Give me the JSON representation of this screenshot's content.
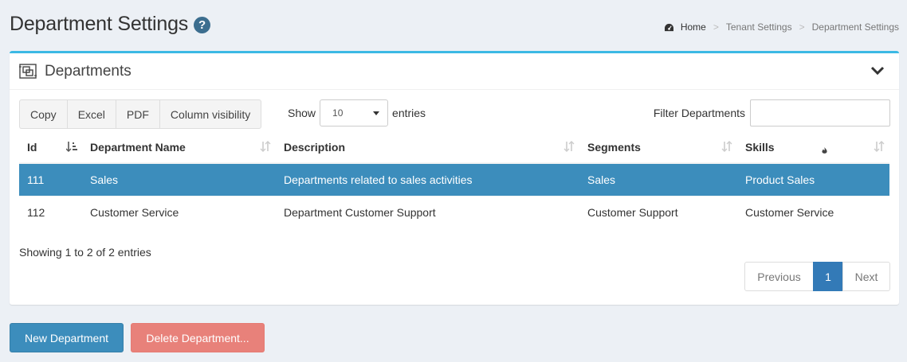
{
  "page": {
    "title": "Department Settings",
    "help_glyph": "?"
  },
  "breadcrumb": {
    "items": [
      "Home",
      "Tenant Settings",
      "Department Settings"
    ],
    "separator": ">"
  },
  "box": {
    "title": "Departments"
  },
  "toolbar": {
    "buttons": [
      "Copy",
      "Excel",
      "PDF",
      "Column visibility"
    ]
  },
  "length": {
    "prefix": "Show",
    "value": "10",
    "suffix": "entries"
  },
  "filter": {
    "label": "Filter Departments",
    "value": ""
  },
  "table": {
    "columns": [
      "Id",
      "Department Name",
      "Description",
      "Segments",
      "Skills"
    ],
    "rows": [
      {
        "id": "111",
        "name": "Sales",
        "description": "Departments related to sales activities",
        "segments": "Sales",
        "skills": "Product Sales"
      },
      {
        "id": "112",
        "name": "Customer Service",
        "description": "Department Customer Support",
        "segments": "Customer Support",
        "skills": "Customer Service"
      }
    ]
  },
  "info": "Showing 1 to 2 of 2 entries",
  "pagination": {
    "previous": "Previous",
    "current": "1",
    "next": "Next"
  },
  "actions": {
    "new_label": "New Department",
    "delete_label": "Delete Department..."
  },
  "colors": {
    "accent": "#3c8dbc",
    "box_border": "#3cb9e4",
    "danger": "#e8817a",
    "background": "#ecf0f5"
  }
}
